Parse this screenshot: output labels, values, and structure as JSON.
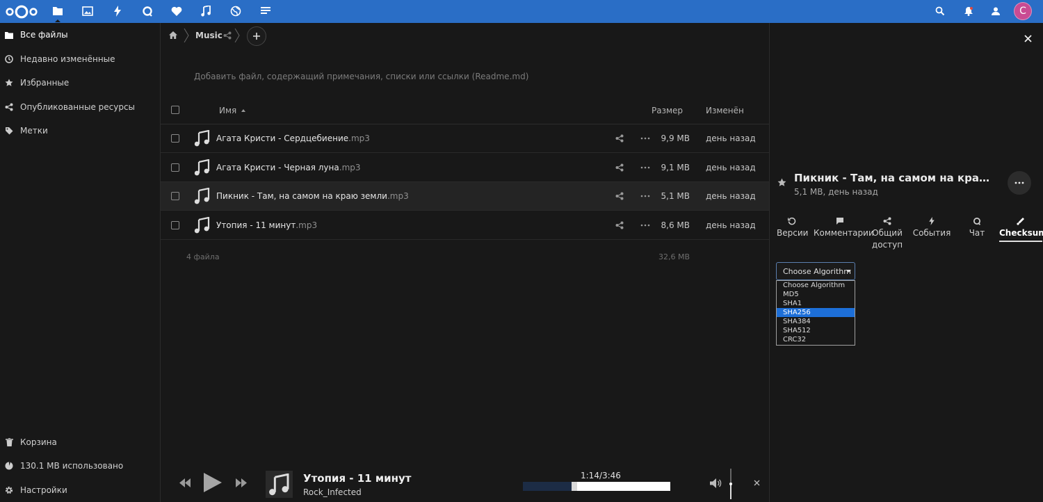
{
  "colors": {
    "header": "#2a6ec6",
    "background": "#181818",
    "avatar": "#c94b93",
    "selection": "#1d6fd8"
  },
  "header": {
    "apps": [
      {
        "name": "files-icon"
      },
      {
        "name": "photos-icon"
      },
      {
        "name": "activity-icon"
      },
      {
        "name": "talk-icon"
      },
      {
        "name": "favorites-icon"
      },
      {
        "name": "music-icon"
      },
      {
        "name": "web-icon"
      },
      {
        "name": "notes-icon"
      }
    ],
    "avatar_letter": "C"
  },
  "nav": {
    "items": [
      {
        "label": "Все файлы",
        "icon": "folder-icon"
      },
      {
        "label": "Недавно изменённые",
        "icon": "clock-icon"
      },
      {
        "label": "Избранные",
        "icon": "star-icon"
      },
      {
        "label": "Опубликованные ресурсы",
        "icon": "share-icon"
      },
      {
        "label": "Метки",
        "icon": "tag-icon"
      }
    ],
    "trash_label": "Корзина",
    "quota_label": "130.1 MB использовано",
    "settings_label": "Настройки"
  },
  "breadcrumb": {
    "folder": "Music"
  },
  "readme_placeholder": "Добавить файл, содержащий примечания, списки или ссылки (Readme.md)",
  "table": {
    "col_name": "Имя",
    "col_size": "Размер",
    "col_modified": "Изменён",
    "rows": [
      {
        "name": "Агата Кристи - Сердцебиение",
        "ext": ".mp3",
        "size": "9,9 MB",
        "mtime": "день назад"
      },
      {
        "name": "Агата Кристи - Черная луна",
        "ext": ".mp3",
        "size": "9,1 MB",
        "mtime": "день назад"
      },
      {
        "name": "Пикник - Там, на самом на краю земли",
        "ext": ".mp3",
        "size": "5,1 MB",
        "mtime": "день назад"
      },
      {
        "name": "Утопия - 11 минут",
        "ext": ".mp3",
        "size": "8,6 MB",
        "mtime": "день назад"
      }
    ],
    "summary_count": "4 файла",
    "summary_size": "32,6 MB"
  },
  "player": {
    "title": "Утопия - 11 минут",
    "artist": "Rock_Infected",
    "time": "1:14/3:46",
    "progress_played": 0.33,
    "progress_buffered": 0.37
  },
  "sidebar": {
    "file_title": "Пикник - Там, на самом на краю зе...",
    "file_meta": "5,1 MB, день назад",
    "tabs": [
      {
        "label": "Версии",
        "icon": "history-icon"
      },
      {
        "label": "Комментарии",
        "icon": "comment-icon"
      },
      {
        "label": "Общий доступ",
        "icon": "share-icon"
      },
      {
        "label": "События",
        "icon": "activity-icon"
      },
      {
        "label": "Чат",
        "icon": "talk-icon"
      },
      {
        "label": "Checksum",
        "icon": "checksum-icon"
      }
    ],
    "algo_selected": "Choose Algorithm",
    "algo_options": [
      "Choose Algorithm",
      "MD5",
      "SHA1",
      "SHA256",
      "SHA384",
      "SHA512",
      "CRC32"
    ],
    "algo_highlighted": "SHA256"
  }
}
